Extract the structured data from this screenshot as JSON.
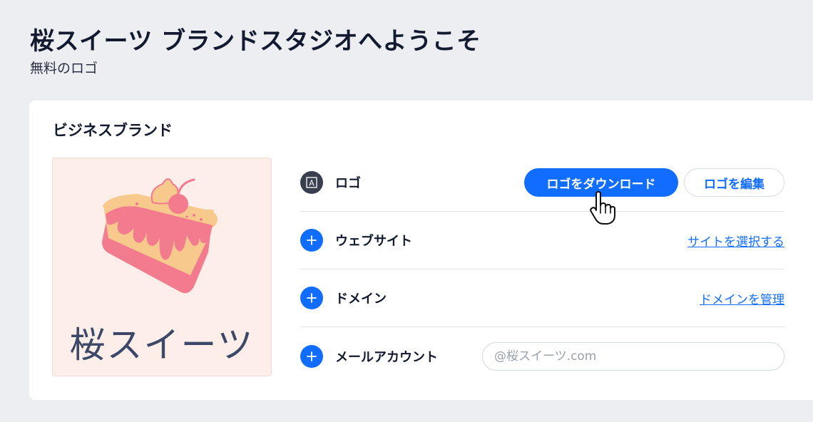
{
  "header": {
    "title": "桜スイーツ ブランドスタジオへようこそ",
    "subtitle": "無料のロゴ"
  },
  "card": {
    "title": "ビジネスブランド",
    "logo_preview": {
      "brand_text": "桜スイーツ",
      "image": "cake-slice-with-cherry-icon"
    },
    "rows": [
      {
        "label": "ロゴ",
        "icon": "logo-A-icon",
        "primary_action": "ロゴをダウンロード",
        "secondary_action": "ロゴを編集"
      },
      {
        "label": "ウェブサイト",
        "icon": "plus-icon",
        "link": "サイトを選択する"
      },
      {
        "label": "ドメイン",
        "icon": "plus-icon",
        "link": "ドメインを管理"
      },
      {
        "label": "メールアカウント",
        "icon": "plus-icon",
        "input_placeholder": "@桜スイーツ.com",
        "input_value": ""
      }
    ]
  },
  "colors": {
    "accent": "#116dff",
    "page_bg": "#eceef2",
    "card_bg": "#ffffff",
    "logo_bg": "#fdeeea",
    "cake_pink": "#f27b8e",
    "cake_cream": "#f8c98c",
    "logo_text": "#3c4867"
  }
}
